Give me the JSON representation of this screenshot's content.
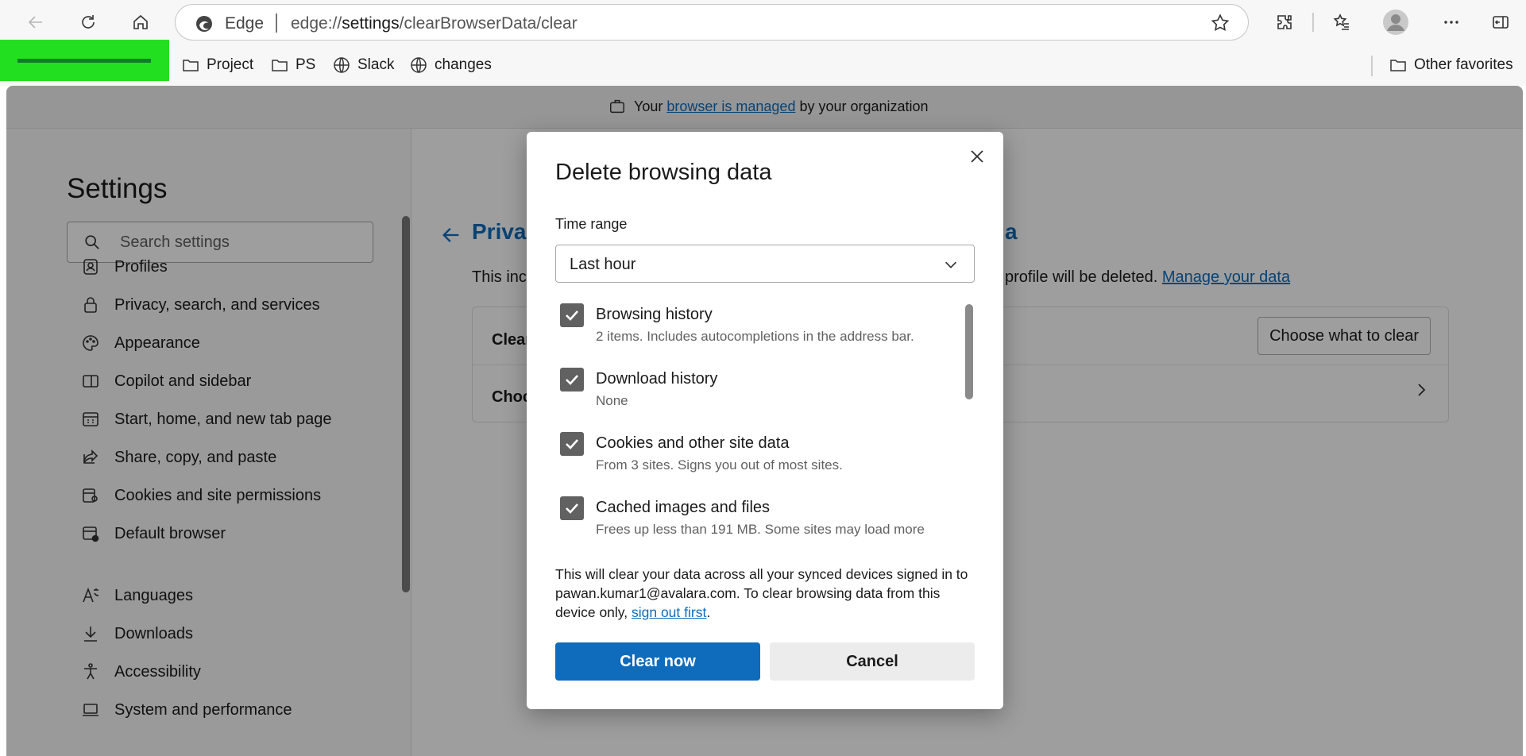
{
  "browser": {
    "brand_label": "Edge",
    "url_prefix": "edge://",
    "url_host": "settings",
    "url_path": "/clearBrowserData/clear",
    "icons": {
      "back": "back-arrow-icon",
      "refresh": "refresh-icon",
      "home": "home-icon",
      "favorite": "star-icon",
      "extensions": "puzzle-icon",
      "favorites": "favorites-icon",
      "profile": "avatar-icon",
      "more": "ellipsis-icon",
      "sidebar": "sidebar-icon"
    }
  },
  "favorites": {
    "items": [
      {
        "label": "Project",
        "icon": "folder-icon"
      },
      {
        "label": "PS",
        "icon": "folder-icon"
      },
      {
        "label": "Slack",
        "icon": "globe-icon"
      },
      {
        "label": "changes",
        "icon": "globe-icon"
      }
    ],
    "other_label": "Other favorites"
  },
  "managed_banner": {
    "prefix": "Your ",
    "link": "browser is managed",
    "suffix": " by your organization"
  },
  "sidebar": {
    "title": "Settings",
    "search_placeholder": "Search settings",
    "items": [
      {
        "label": "Profiles",
        "icon": "profile-icon"
      },
      {
        "label": "Privacy, search, and services",
        "icon": "lock-icon"
      },
      {
        "label": "Appearance",
        "icon": "palette-icon"
      },
      {
        "label": "Copilot and sidebar",
        "icon": "sidebar-panel-icon"
      },
      {
        "label": "Start, home, and new tab page",
        "icon": "home-grid-icon"
      },
      {
        "label": "Share, copy, and paste",
        "icon": "share-icon"
      },
      {
        "label": "Cookies and site permissions",
        "icon": "cookie-permissions-icon"
      },
      {
        "label": "Default browser",
        "icon": "default-browser-icon"
      },
      {
        "label": "Languages",
        "icon": "language-icon"
      },
      {
        "label": "Downloads",
        "icon": "download-icon"
      },
      {
        "label": "Accessibility",
        "icon": "accessibility-icon"
      },
      {
        "label": "System and performance",
        "icon": "laptop-icon"
      }
    ]
  },
  "main": {
    "title_start": "Priva",
    "title_end": "a",
    "desc_start": "This inc",
    "desc_end": "profile will be deleted. ",
    "desc_link": "Manage your data",
    "card": {
      "row1_label": "Clear",
      "row2_label": "Choc",
      "choose_button": "Choose what to clear"
    }
  },
  "dialog": {
    "title": "Delete browsing data",
    "time_range_label": "Time range",
    "time_range_value": "Last hour",
    "options": [
      {
        "title": "Browsing history",
        "subtitle": "2 items. Includes autocompletions in the address bar.",
        "checked": true
      },
      {
        "title": "Download history",
        "subtitle": "None",
        "checked": true
      },
      {
        "title": "Cookies and other site data",
        "subtitle": "From 3 sites. Signs you out of most sites.",
        "checked": true
      },
      {
        "title": "Cached images and files",
        "subtitle": "Frees up less than 191 MB. Some sites may load more",
        "checked": true
      }
    ],
    "sync_note": "This will clear your data across all your synced devices signed in to pawan.kumar1@avalara.com. To clear browsing data from this device only, ",
    "sync_link": "sign out first",
    "sync_end": ".",
    "clear_button": "Clear now",
    "cancel_button": "Cancel"
  },
  "colors": {
    "accent": "#0f6cbd",
    "checkbox": "#616161",
    "green_block": "#22e01f"
  }
}
